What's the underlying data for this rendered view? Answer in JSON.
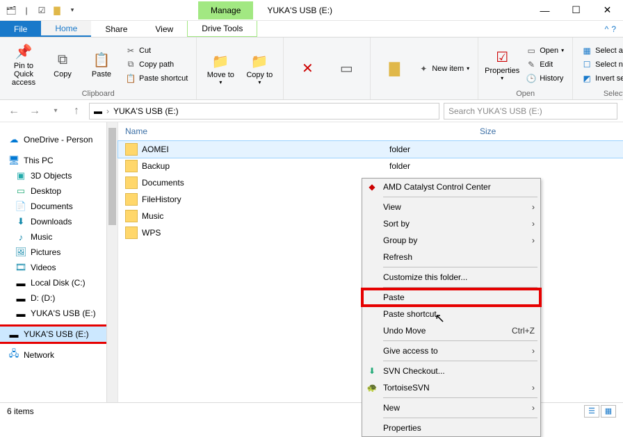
{
  "title": "YUKA'S USB (E:)",
  "ribbon_context": "Manage",
  "tabs": {
    "file": "File",
    "home": "Home",
    "share": "Share",
    "view": "View",
    "drivetools": "Drive Tools"
  },
  "ribbon": {
    "pin": "Pin to Quick access",
    "copy": "Copy",
    "paste": "Paste",
    "cut": "Cut",
    "copypath": "Copy path",
    "pasteshortcut": "Paste shortcut",
    "clipboard_label": "Clipboard",
    "moveto": "Move to",
    "copyto": "Copy to",
    "newitem": "New item",
    "properties": "Properties",
    "open": "Open",
    "edit": "Edit",
    "history": "History",
    "open_label": "Open",
    "selectall": "Select all",
    "selectnone": "Select none",
    "invert": "Invert selection",
    "select_label": "Select"
  },
  "address": {
    "path": "YUKA'S USB (E:)",
    "search_placeholder": "Search YUKA'S USB (E:)"
  },
  "nav": {
    "onedrive": "OneDrive - Person",
    "thispc": "This PC",
    "items": [
      "3D Objects",
      "Desktop",
      "Documents",
      "Downloads",
      "Music",
      "Pictures",
      "Videos",
      "Local Disk (C:)",
      "D: (D:)",
      "YUKA'S USB (E:)",
      "YUKA'S USB (E:)"
    ],
    "network": "Network"
  },
  "columns": {
    "name": "Name",
    "modified": "",
    "type": "",
    "size": "Size"
  },
  "files": [
    {
      "name": "AOMEI",
      "type": "folder"
    },
    {
      "name": "Backup",
      "type": "folder"
    },
    {
      "name": "Documents",
      "type": "folder"
    },
    {
      "name": "FileHistory",
      "type": "folder"
    },
    {
      "name": "Music",
      "type": "folder"
    },
    {
      "name": "WPS",
      "type": "folder"
    }
  ],
  "context_menu": {
    "amd": "AMD Catalyst Control Center",
    "view": "View",
    "sortby": "Sort by",
    "groupby": "Group by",
    "refresh": "Refresh",
    "customize": "Customize this folder...",
    "paste": "Paste",
    "pasteshortcut": "Paste shortcut",
    "undomove": "Undo Move",
    "undomove_key": "Ctrl+Z",
    "giveaccess": "Give access to",
    "svncheckout": "SVN Checkout...",
    "tortoise": "TortoiseSVN",
    "new": "New",
    "properties": "Properties"
  },
  "status": "6 items"
}
